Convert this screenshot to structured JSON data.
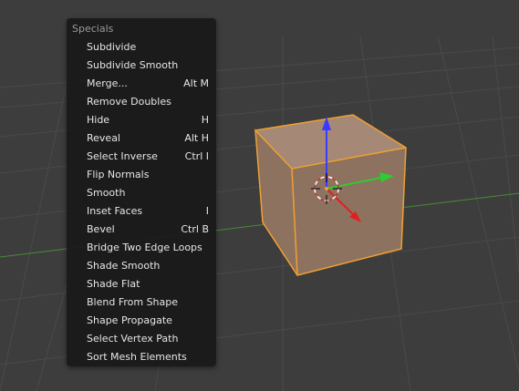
{
  "viewport": {
    "grid_color": "#4a4a4a",
    "x_axis_color": "#4a8a3a",
    "cube_fill": "#8d7260",
    "cube_top_fill": "#a58976",
    "cube_edge_color": "#f0a030",
    "gizmo_z_color": "#3a3aff",
    "gizmo_y_color": "#2ecc2e",
    "gizmo_x_color": "#e02020"
  },
  "menu": {
    "title": "Specials",
    "items": [
      {
        "label": "Subdivide",
        "shortcut": ""
      },
      {
        "label": "Subdivide Smooth",
        "shortcut": ""
      },
      {
        "label": "Merge...",
        "shortcut": "Alt M"
      },
      {
        "label": "Remove Doubles",
        "shortcut": ""
      },
      {
        "label": "Hide",
        "shortcut": "H"
      },
      {
        "label": "Reveal",
        "shortcut": "Alt H"
      },
      {
        "label": "Select Inverse",
        "shortcut": "Ctrl I"
      },
      {
        "label": "Flip Normals",
        "shortcut": ""
      },
      {
        "label": "Smooth",
        "shortcut": ""
      },
      {
        "label": "Inset Faces",
        "shortcut": "I"
      },
      {
        "label": "Bevel",
        "shortcut": "Ctrl B"
      },
      {
        "label": "Bridge Two Edge Loops",
        "shortcut": ""
      },
      {
        "label": "Shade Smooth",
        "shortcut": ""
      },
      {
        "label": "Shade Flat",
        "shortcut": ""
      },
      {
        "label": "Blend From Shape",
        "shortcut": ""
      },
      {
        "label": "Shape Propagate",
        "shortcut": ""
      },
      {
        "label": "Select Vertex Path",
        "shortcut": ""
      },
      {
        "label": "Sort Mesh Elements",
        "shortcut": ""
      }
    ]
  }
}
